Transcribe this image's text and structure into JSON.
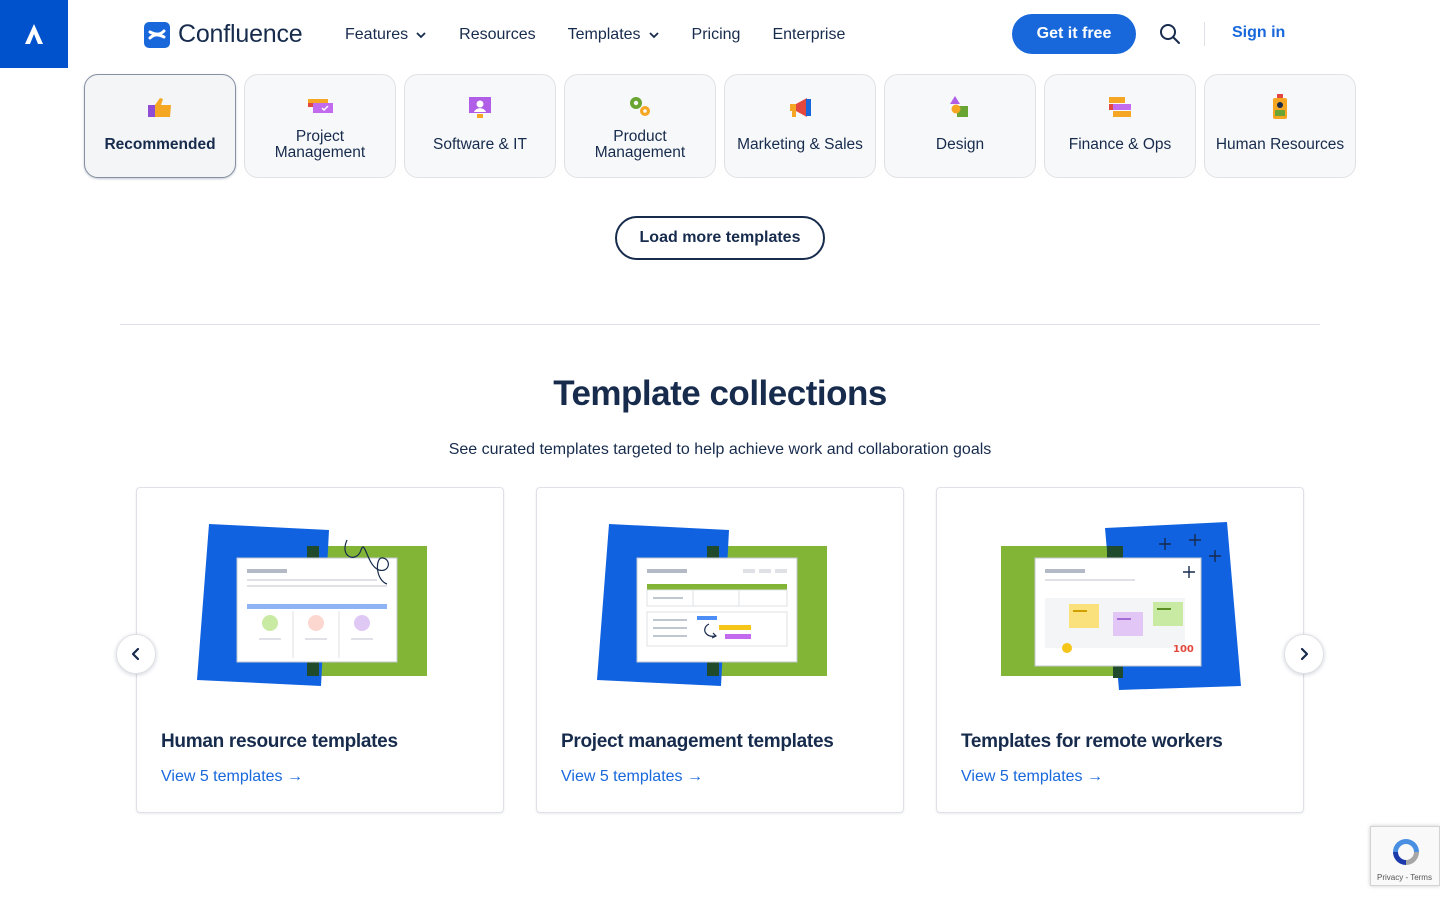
{
  "nav": {
    "logo_text": "Confluence",
    "items": [
      {
        "label": "Features",
        "has_dropdown": true
      },
      {
        "label": "Resources",
        "has_dropdown": false
      },
      {
        "label": "Templates",
        "has_dropdown": true
      },
      {
        "label": "Pricing",
        "has_dropdown": false
      },
      {
        "label": "Enterprise",
        "has_dropdown": false
      }
    ],
    "cta_label": "Get it free",
    "signin_label": "Sign in",
    "icons": [
      "atlassian-logo-icon",
      "confluence-logo-icon",
      "search-icon",
      "chevron-down-icon"
    ]
  },
  "categories": [
    {
      "label": "Recommended",
      "icon": "thumbs-up-icon",
      "active": true
    },
    {
      "label": "Project Management",
      "icon": "project-cards-icon",
      "active": false
    },
    {
      "label": "Software & IT",
      "icon": "monitor-icon",
      "active": false
    },
    {
      "label": "Product Management",
      "icon": "gears-icon",
      "active": false
    },
    {
      "label": "Marketing & Sales",
      "icon": "megaphone-icon",
      "active": false
    },
    {
      "label": "Design",
      "icon": "shapes-icon",
      "active": false
    },
    {
      "label": "Finance & Ops",
      "icon": "ledger-icon",
      "active": false
    },
    {
      "label": "Human Resources",
      "icon": "id-badge-icon",
      "active": false
    }
  ],
  "load_more_label": "Load more templates",
  "collections": {
    "title": "Template collections",
    "subtitle": "See curated templates targeted to help achieve work and collaboration goals",
    "cards": [
      {
        "title": "Human resource templates",
        "link": "View 5 templates →"
      },
      {
        "title": "Project management templates",
        "link": "View 5 templates →"
      },
      {
        "title": "Templates for remote workers",
        "link": "View 5 templates →"
      }
    ],
    "prev_icon": "chevron-left-icon",
    "next_icon": "chevron-right-icon"
  },
  "recaptcha": {
    "links": "Privacy - Terms"
  },
  "colors": {
    "brand_blue": "#1868db",
    "atlassian_blue": "#0052cc",
    "text": "#172b4d",
    "illus_blue": "#1062e0",
    "illus_green": "#82b536"
  }
}
